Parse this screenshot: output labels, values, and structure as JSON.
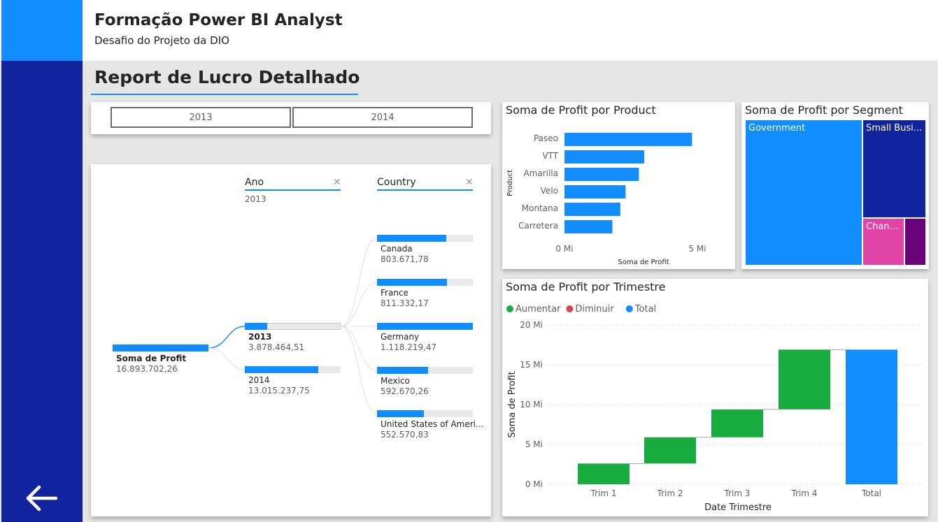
{
  "header": {
    "title": "Formação Power BI Analyst",
    "subtitle": "Desafio do Projeto da DIO"
  },
  "report": {
    "title": "Report de Lucro Detalhado"
  },
  "slicer": {
    "options": [
      "2013",
      "2014"
    ]
  },
  "decomposition_tree": {
    "levels": [
      {
        "name": "Ano",
        "filter": "2013"
      },
      {
        "name": "Country",
        "filter": ""
      }
    ],
    "root": {
      "label": "Soma de Profit",
      "value": "16.893.702,26"
    },
    "years": [
      {
        "label": "2013",
        "value": "3.878.464,51",
        "fill": 0.23,
        "selected": true
      },
      {
        "label": "2014",
        "value": "13.015.237,75",
        "fill": 0.77,
        "selected": false
      }
    ],
    "countries": [
      {
        "label": "Canada",
        "value": "803.671,78",
        "fill": 0.72
      },
      {
        "label": "France",
        "value": "811.332,17",
        "fill": 0.73
      },
      {
        "label": "Germany",
        "value": "1.118.219,47",
        "fill": 1.0
      },
      {
        "label": "Mexico",
        "value": "592.670,26",
        "fill": 0.53
      },
      {
        "label": "United States of Ameri...",
        "value": "552.570,83",
        "fill": 0.49
      }
    ]
  },
  "product_chart": {
    "title": "Soma de Profit por Product",
    "colors": {
      "bar": "#118dff"
    }
  },
  "segment_chart": {
    "title": "Soma de Profit por Segment",
    "segments": [
      {
        "label": "Government",
        "color": "#118dff"
      },
      {
        "label": "Small Busi...",
        "color": "#12239e"
      },
      {
        "label": "Chan...",
        "color": "#e044a7"
      },
      {
        "label": "",
        "color": "#6b007b"
      }
    ]
  },
  "trimestre_chart": {
    "title": "Soma de Profit por Trimestre",
    "legend": [
      {
        "label": "Aumentar",
        "color": "#1aab40"
      },
      {
        "label": "Diminuir",
        "color": "#d64554"
      },
      {
        "label": "Total",
        "color": "#118dff"
      }
    ]
  },
  "chart_data": [
    {
      "type": "bar",
      "orientation": "horizontal",
      "title": "Soma de Profit por Product",
      "categories": [
        "Paseo",
        "VTT",
        "Amarilla",
        "Velo",
        "Montana",
        "Carretera"
      ],
      "values": [
        4.8,
        3.0,
        2.8,
        2.3,
        2.1,
        1.8
      ],
      "unit": "Mi",
      "xlabel": "Soma de Profit",
      "ylabel": "Product",
      "xticks": [
        "0 Mi",
        "5 Mi"
      ],
      "xlim": [
        0,
        5
      ]
    },
    {
      "type": "waterfall",
      "title": "Soma de Profit por Trimestre",
      "categories": [
        "Trim 1",
        "Trim 2",
        "Trim 3",
        "Trim 4",
        "Total"
      ],
      "values": [
        2.6,
        3.3,
        3.5,
        7.5,
        16.9
      ],
      "unit": "Mi",
      "xlabel": "Date Trimestre",
      "ylabel": "Soma de Profit",
      "yticks": [
        "0 Mi",
        "5 Mi",
        "10 Mi",
        "15 Mi",
        "20 Mi"
      ],
      "ylim": [
        0,
        20
      ]
    }
  ]
}
